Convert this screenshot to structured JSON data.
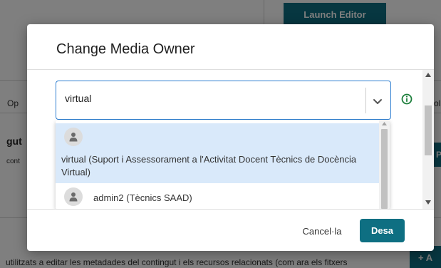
{
  "background": {
    "launch_editor": "Launch Editor",
    "col_left_fragment": "Op",
    "col_right_fragment": "ol",
    "heading_fragment": "gut",
    "sub_fragment": "cont",
    "side_button": "P",
    "add_button": "+ A",
    "footer_line": "utilitzats a editar les metadades del contingut i els recursos relacionats (com ara els fitxers"
  },
  "modal": {
    "title": "Change Media Owner",
    "select": {
      "value": "virtual"
    },
    "options": [
      {
        "label": "virtual (Suport i Assessorament a l'Activitat Docent Tècnics de Docència Virtual)"
      },
      {
        "label": "admin2 (Tècnics SAAD)"
      }
    ],
    "footer": {
      "cancel_label": "Cancel·la",
      "save_label": "Desa"
    }
  },
  "colors": {
    "accent": "#0e6f82",
    "focus_border": "#2f7fd1",
    "highlighted_option": "#d9e9fa",
    "info_icon": "#1d7f3c"
  },
  "icons": {
    "dropdown": "chevron-down-icon",
    "info": "info-icon",
    "user": "user-icon"
  }
}
